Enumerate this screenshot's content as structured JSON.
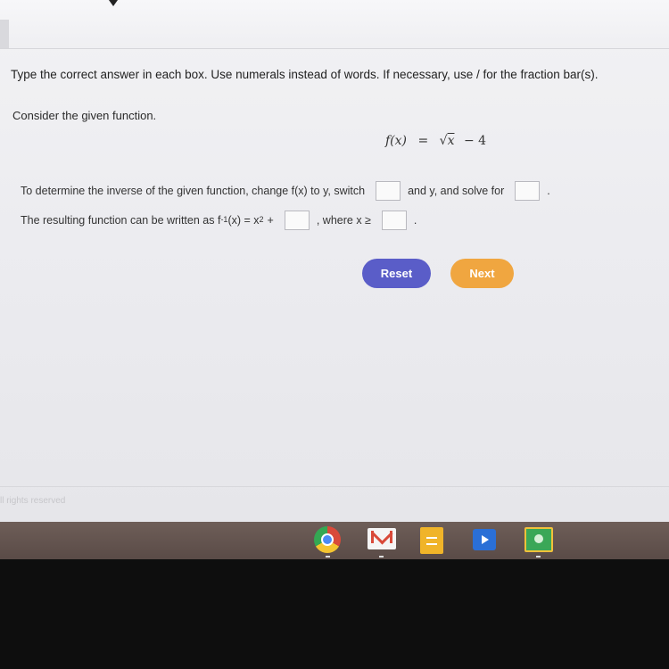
{
  "instructions": "Type the correct answer in each box. Use numerals instead of words. If necessary, use / for the fraction bar(s).",
  "consider": "Consider the given function.",
  "function": {
    "lhs": "f(x)",
    "eq": "=",
    "rhs_var": "x",
    "rhs_rest": "− 4"
  },
  "line1": {
    "part1": "To determine the inverse of the given function, change f(x) to y, switch",
    "part2": "and y, and solve for",
    "part3": "."
  },
  "line2": {
    "part1": "The resulting function can be written as f",
    "sup1": "-1",
    "part2": "(x) = x",
    "sup2": "2",
    "part3": "+",
    "part4": ", where x ≥",
    "part5": "."
  },
  "buttons": {
    "reset": "Reset",
    "next": "Next"
  },
  "footer": "ll rights reserved",
  "dock": [
    "chrome-icon",
    "gmail-icon",
    "docs-icon",
    "play-icon",
    "classroom-icon"
  ],
  "colors": {
    "reset": "#5a5dc8",
    "next": "#f0a640"
  }
}
